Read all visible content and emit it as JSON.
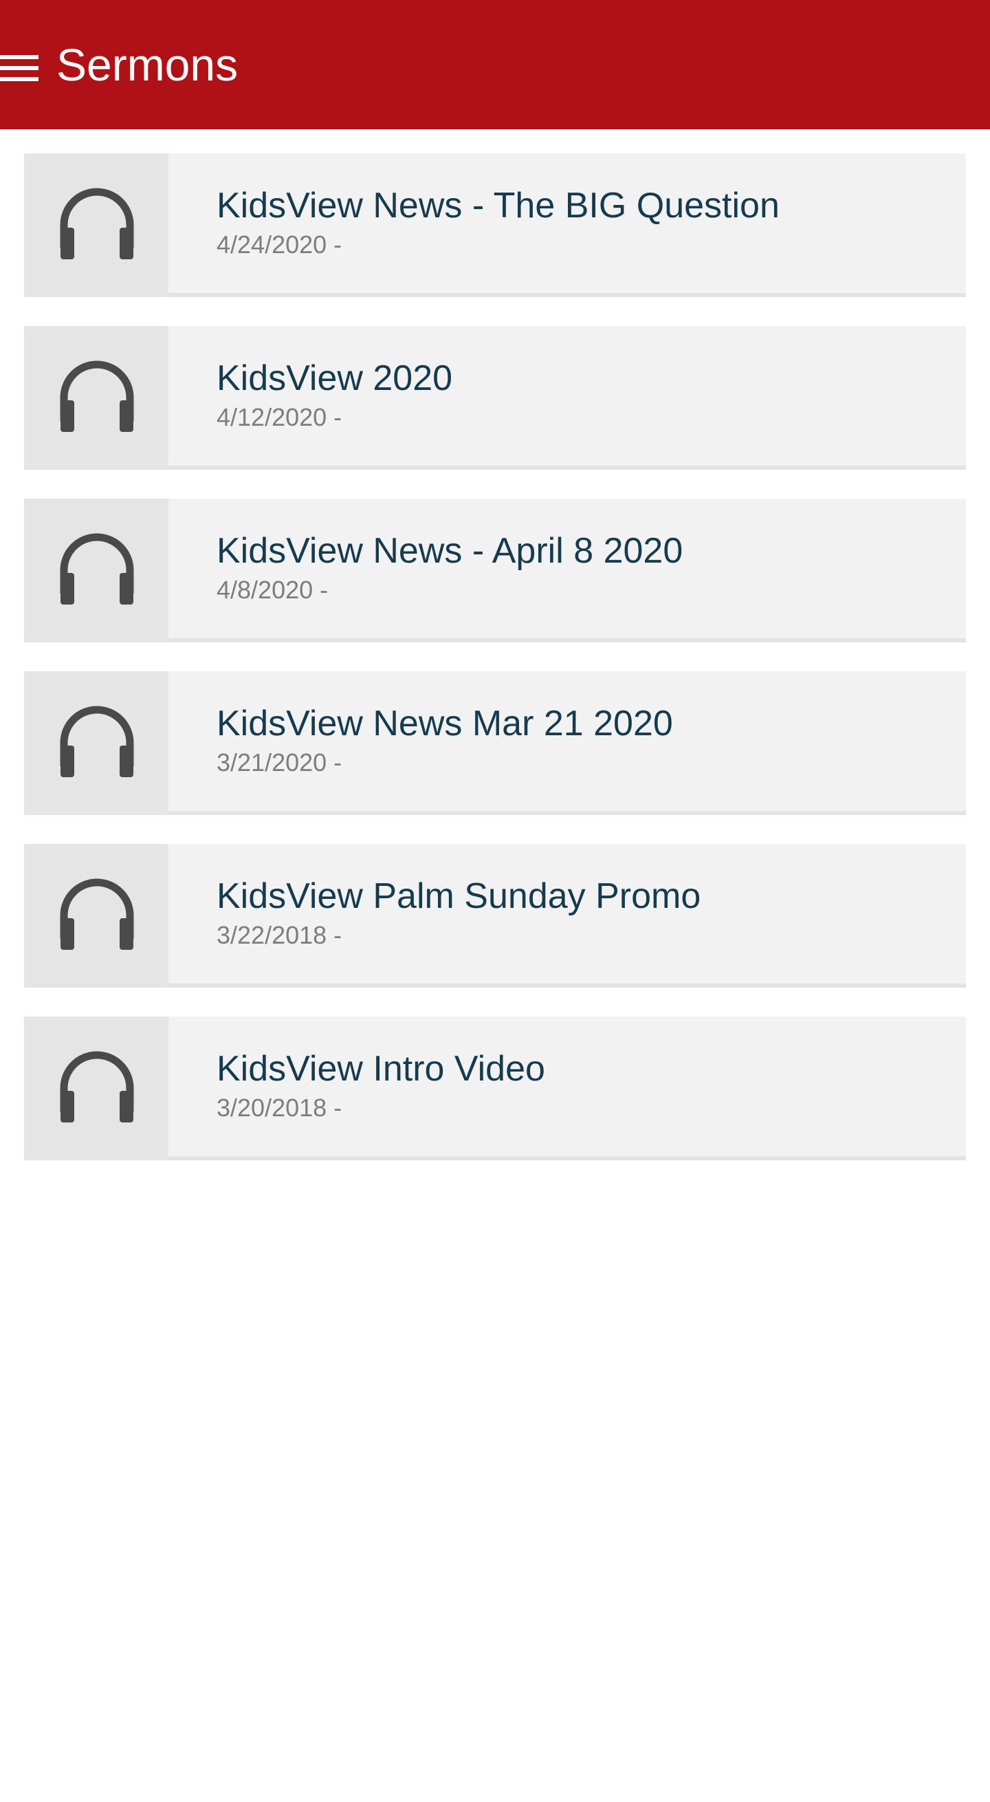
{
  "header": {
    "title": "Sermons",
    "menu_icon": "hamburger-menu-icon",
    "background_color": "#b01116"
  },
  "sermons": [
    {
      "title": "KidsView News - The BIG Question",
      "date": "4/24/2020 -",
      "icon": "headphones-icon"
    },
    {
      "title": "KidsView 2020",
      "date": "4/12/2020 -",
      "icon": "headphones-icon"
    },
    {
      "title": "KidsView News - April 8 2020",
      "date": "4/8/2020 -",
      "icon": "headphones-icon"
    },
    {
      "title": "KidsView News Mar 21 2020",
      "date": "3/21/2020 -",
      "icon": "headphones-icon"
    },
    {
      "title": "KidsView Palm Sunday Promo",
      "date": "3/22/2018 -",
      "icon": "headphones-icon"
    },
    {
      "title": "KidsView Intro Video",
      "date": "3/20/2018 -",
      "icon": "headphones-icon"
    }
  ]
}
